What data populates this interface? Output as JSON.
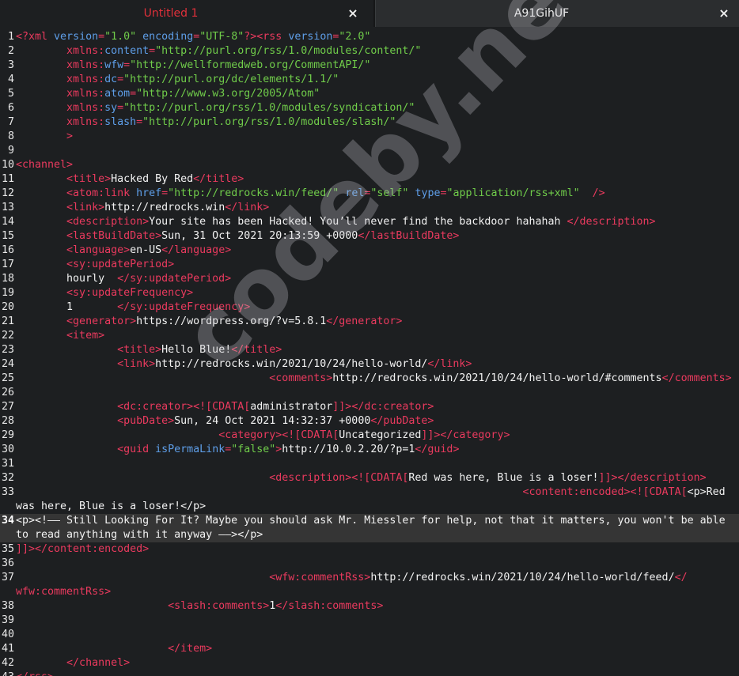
{
  "tabs": [
    {
      "label": "Untitled 1",
      "close": "×",
      "active": true,
      "color": "#e0303a"
    },
    {
      "label": "A91GihUF",
      "close": "×",
      "active": false,
      "color": "#f0f0f0"
    }
  ],
  "watermark": "codeby.net",
  "colors": {
    "tag": "#ea3a5e",
    "attr": "#5e9ee8",
    "string": "#70cc4a",
    "text": "#f2f2f2",
    "background": "#1d1f21"
  },
  "lines": [
    {
      "n": "1",
      "segs": [
        {
          "c": "t",
          "x": "<?xml "
        },
        {
          "c": "a",
          "x": "version"
        },
        {
          "c": "t",
          "x": "="
        },
        {
          "c": "s",
          "x": "\"1.0\""
        },
        {
          "c": "t",
          "x": " "
        },
        {
          "c": "a",
          "x": "encoding"
        },
        {
          "c": "t",
          "x": "="
        },
        {
          "c": "s",
          "x": "\"UTF-8\""
        },
        {
          "c": "t",
          "x": "?><rss "
        },
        {
          "c": "a",
          "x": "version"
        },
        {
          "c": "t",
          "x": "="
        },
        {
          "c": "s",
          "x": "\"2.0\""
        }
      ]
    },
    {
      "n": "2",
      "segs": [
        {
          "c": "p",
          "x": "        "
        },
        {
          "c": "t",
          "x": "xmlns:"
        },
        {
          "c": "a",
          "x": "content"
        },
        {
          "c": "t",
          "x": "="
        },
        {
          "c": "s",
          "x": "\"http://purl.org/rss/1.0/modules/content/\""
        }
      ]
    },
    {
      "n": "3",
      "segs": [
        {
          "c": "p",
          "x": "        "
        },
        {
          "c": "t",
          "x": "xmlns:"
        },
        {
          "c": "a",
          "x": "wfw"
        },
        {
          "c": "t",
          "x": "="
        },
        {
          "c": "s",
          "x": "\"http://wellformedweb.org/CommentAPI/\""
        }
      ]
    },
    {
      "n": "4",
      "segs": [
        {
          "c": "p",
          "x": "        "
        },
        {
          "c": "t",
          "x": "xmlns:"
        },
        {
          "c": "a",
          "x": "dc"
        },
        {
          "c": "t",
          "x": "="
        },
        {
          "c": "s",
          "x": "\"http://purl.org/dc/elements/1.1/\""
        }
      ]
    },
    {
      "n": "5",
      "segs": [
        {
          "c": "p",
          "x": "        "
        },
        {
          "c": "t",
          "x": "xmlns:"
        },
        {
          "c": "a",
          "x": "atom"
        },
        {
          "c": "t",
          "x": "="
        },
        {
          "c": "s",
          "x": "\"http://www.w3.org/2005/Atom\""
        }
      ]
    },
    {
      "n": "6",
      "segs": [
        {
          "c": "p",
          "x": "        "
        },
        {
          "c": "t",
          "x": "xmlns:"
        },
        {
          "c": "a",
          "x": "sy"
        },
        {
          "c": "t",
          "x": "="
        },
        {
          "c": "s",
          "x": "\"http://purl.org/rss/1.0/modules/syndication/\""
        }
      ]
    },
    {
      "n": "7",
      "segs": [
        {
          "c": "p",
          "x": "        "
        },
        {
          "c": "t",
          "x": "xmlns:"
        },
        {
          "c": "a",
          "x": "slash"
        },
        {
          "c": "t",
          "x": "="
        },
        {
          "c": "s",
          "x": "\"http://purl.org/rss/1.0/modules/slash/\""
        }
      ]
    },
    {
      "n": "8",
      "segs": [
        {
          "c": "p",
          "x": "        "
        },
        {
          "c": "t",
          "x": ">"
        }
      ]
    },
    {
      "n": "9",
      "segs": []
    },
    {
      "n": "10",
      "segs": [
        {
          "c": "t",
          "x": "<channel>"
        }
      ]
    },
    {
      "n": "11",
      "segs": [
        {
          "c": "p",
          "x": "        "
        },
        {
          "c": "t",
          "x": "<title>"
        },
        {
          "c": "p",
          "x": "Hacked By Red"
        },
        {
          "c": "t",
          "x": "</title>"
        }
      ]
    },
    {
      "n": "12",
      "segs": [
        {
          "c": "p",
          "x": "        "
        },
        {
          "c": "t",
          "x": "<atom:link "
        },
        {
          "c": "a",
          "x": "href"
        },
        {
          "c": "t",
          "x": "="
        },
        {
          "c": "s",
          "x": "\"http://redrocks.win/feed/\""
        },
        {
          "c": "t",
          "x": " "
        },
        {
          "c": "a",
          "x": "rel"
        },
        {
          "c": "t",
          "x": "="
        },
        {
          "c": "s",
          "x": "\"self\""
        },
        {
          "c": "t",
          "x": " "
        },
        {
          "c": "a",
          "x": "type"
        },
        {
          "c": "t",
          "x": "="
        },
        {
          "c": "s",
          "x": "\"application/rss+xml\""
        },
        {
          "c": "t",
          "x": "  />"
        }
      ]
    },
    {
      "n": "13",
      "segs": [
        {
          "c": "p",
          "x": "        "
        },
        {
          "c": "t",
          "x": "<link>"
        },
        {
          "c": "p",
          "x": "http://redrocks.win"
        },
        {
          "c": "t",
          "x": "</link>"
        }
      ]
    },
    {
      "n": "14",
      "segs": [
        {
          "c": "p",
          "x": "        "
        },
        {
          "c": "t",
          "x": "<description>"
        },
        {
          "c": "p",
          "x": "Your site has been Hacked! You’ll never find the backdoor hahahah "
        },
        {
          "c": "t",
          "x": "</description>"
        }
      ]
    },
    {
      "n": "15",
      "segs": [
        {
          "c": "p",
          "x": "        "
        },
        {
          "c": "t",
          "x": "<lastBuildDate>"
        },
        {
          "c": "p",
          "x": "Sun, 31 Oct 2021 20:13:59 +0000"
        },
        {
          "c": "t",
          "x": "</lastBuildDate>"
        }
      ]
    },
    {
      "n": "16",
      "segs": [
        {
          "c": "p",
          "x": "        "
        },
        {
          "c": "t",
          "x": "<language>"
        },
        {
          "c": "p",
          "x": "en-US"
        },
        {
          "c": "t",
          "x": "</language>"
        }
      ]
    },
    {
      "n": "17",
      "segs": [
        {
          "c": "p",
          "x": "        "
        },
        {
          "c": "t",
          "x": "<sy:updatePeriod>"
        }
      ]
    },
    {
      "n": "18",
      "segs": [
        {
          "c": "p",
          "x": "        hourly  "
        },
        {
          "c": "t",
          "x": "</sy:updatePeriod>"
        }
      ]
    },
    {
      "n": "19",
      "segs": [
        {
          "c": "p",
          "x": "        "
        },
        {
          "c": "t",
          "x": "<sy:updateFrequency>"
        }
      ]
    },
    {
      "n": "20",
      "segs": [
        {
          "c": "p",
          "x": "        1       "
        },
        {
          "c": "t",
          "x": "</sy:updateFrequency>"
        }
      ]
    },
    {
      "n": "21",
      "segs": [
        {
          "c": "p",
          "x": "        "
        },
        {
          "c": "t",
          "x": "<generator>"
        },
        {
          "c": "p",
          "x": "https://wordpress.org/?v=5.8.1"
        },
        {
          "c": "t",
          "x": "</generator>"
        }
      ]
    },
    {
      "n": "22",
      "segs": [
        {
          "c": "p",
          "x": "        "
        },
        {
          "c": "t",
          "x": "<item>"
        }
      ]
    },
    {
      "n": "23",
      "segs": [
        {
          "c": "p",
          "x": "                "
        },
        {
          "c": "t",
          "x": "<title>"
        },
        {
          "c": "p",
          "x": "Hello Blue!"
        },
        {
          "c": "t",
          "x": "</title>"
        }
      ]
    },
    {
      "n": "24",
      "segs": [
        {
          "c": "p",
          "x": "                "
        },
        {
          "c": "t",
          "x": "<link>"
        },
        {
          "c": "p",
          "x": "http://redrocks.win/2021/10/24/hello-world/"
        },
        {
          "c": "t",
          "x": "</link>"
        }
      ]
    },
    {
      "n": "25",
      "segs": [
        {
          "c": "p",
          "x": "                                        "
        },
        {
          "c": "t",
          "x": "<comments>"
        },
        {
          "c": "p",
          "x": "http://redrocks.win/2021/10/24/hello-world/#comments"
        },
        {
          "c": "t",
          "x": "</comments>"
        }
      ]
    },
    {
      "n": "26",
      "segs": []
    },
    {
      "n": "27",
      "segs": [
        {
          "c": "p",
          "x": "                "
        },
        {
          "c": "t",
          "x": "<dc:creator><![CDATA["
        },
        {
          "c": "p",
          "x": "administrator"
        },
        {
          "c": "t",
          "x": "]]></dc:creator>"
        }
      ]
    },
    {
      "n": "28",
      "segs": [
        {
          "c": "p",
          "x": "                "
        },
        {
          "c": "t",
          "x": "<pubDate>"
        },
        {
          "c": "p",
          "x": "Sun, 24 Oct 2021 14:32:37 +0000"
        },
        {
          "c": "t",
          "x": "</pubDate>"
        }
      ]
    },
    {
      "n": "29",
      "segs": [
        {
          "c": "p",
          "x": "                                "
        },
        {
          "c": "t",
          "x": "<category><![CDATA["
        },
        {
          "c": "p",
          "x": "Uncategorized"
        },
        {
          "c": "t",
          "x": "]]></category>"
        }
      ]
    },
    {
      "n": "30",
      "segs": [
        {
          "c": "p",
          "x": "                "
        },
        {
          "c": "t",
          "x": "<guid "
        },
        {
          "c": "a",
          "x": "isPermaLink"
        },
        {
          "c": "t",
          "x": "="
        },
        {
          "c": "s",
          "x": "\"false\""
        },
        {
          "c": "t",
          "x": ">"
        },
        {
          "c": "p",
          "x": "http://10.0.2.20/?p=1"
        },
        {
          "c": "t",
          "x": "</guid>"
        }
      ]
    },
    {
      "n": "31",
      "segs": []
    },
    {
      "n": "32",
      "segs": [
        {
          "c": "p",
          "x": "                                        "
        },
        {
          "c": "t",
          "x": "<description><![CDATA["
        },
        {
          "c": "p",
          "x": "Red was here, Blue is a loser!"
        },
        {
          "c": "t",
          "x": "]]></description>"
        }
      ]
    },
    {
      "n": "33",
      "tall": true,
      "segs": [
        {
          "c": "p",
          "x": "                                                                                "
        },
        {
          "c": "t",
          "x": "<content:encoded><![CDATA["
        },
        {
          "c": "p",
          "x": "<p>Red\nwas here, Blue is a loser!</p>"
        }
      ]
    },
    {
      "n": "34",
      "tall": true,
      "current": true,
      "segs": [
        {
          "c": "p",
          "x": "<p><!–– Still Looking For It? Maybe you should ask Mr. Miessler for help, not that it matters, you won't be able\nto read anything with it anyway ––></p>"
        }
      ]
    },
    {
      "n": "35",
      "segs": [
        {
          "c": "t",
          "x": "]]></content:encoded>"
        }
      ]
    },
    {
      "n": "36",
      "segs": []
    },
    {
      "n": "37",
      "tall": true,
      "segs": [
        {
          "c": "p",
          "x": "                                        "
        },
        {
          "c": "t",
          "x": "<wfw:commentRss>"
        },
        {
          "c": "p",
          "x": "http://redrocks.win/2021/10/24/hello-world/feed/"
        },
        {
          "c": "t",
          "x": "</\nwfw:commentRss>"
        }
      ]
    },
    {
      "n": "38",
      "segs": [
        {
          "c": "p",
          "x": "                        "
        },
        {
          "c": "t",
          "x": "<slash:comments>"
        },
        {
          "c": "p",
          "x": "1"
        },
        {
          "c": "t",
          "x": "</slash:comments>"
        }
      ]
    },
    {
      "n": "39",
      "segs": []
    },
    {
      "n": "40",
      "segs": []
    },
    {
      "n": "41",
      "segs": [
        {
          "c": "p",
          "x": "                        "
        },
        {
          "c": "t",
          "x": "</item>"
        }
      ]
    },
    {
      "n": "42",
      "segs": [
        {
          "c": "p",
          "x": "        "
        },
        {
          "c": "t",
          "x": "</channel>"
        }
      ]
    },
    {
      "n": "43",
      "segs": [
        {
          "c": "t",
          "x": "</rss>"
        }
      ]
    }
  ]
}
